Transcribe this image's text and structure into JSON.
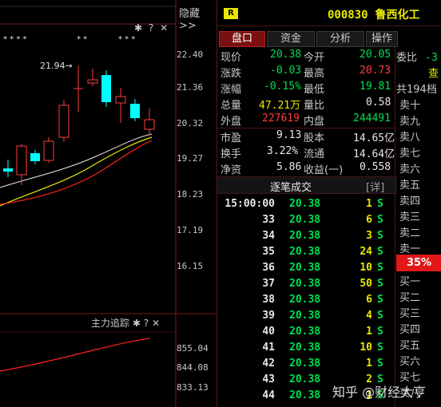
{
  "chart": {
    "hide_label": "隐藏>>",
    "ytick_labels": [
      "22.40",
      "21.36",
      "20.32",
      "19.27",
      "18.23",
      "17.19",
      "16.15"
    ],
    "price_annotation": "21.94→",
    "indicator_title": "主力追踪",
    "indicator_ticks": [
      "855.04",
      "844.08",
      "833.13"
    ],
    "question_label": "?",
    "close_label": "✕"
  },
  "header": {
    "badge": "R",
    "code": "000830",
    "name": "鲁西化工"
  },
  "tabs": [
    {
      "label": "盘口",
      "active": true
    },
    {
      "label": "资金",
      "active": false
    },
    {
      "label": "分析",
      "active": false
    },
    {
      "label": "操作",
      "active": false
    }
  ],
  "quote": {
    "xianjia_label": "现价",
    "xianjia": "20.38",
    "jinkai_label": "今开",
    "jinkai": "20.05",
    "zhangdie_label": "涨跌",
    "zhangdie": "-0.03",
    "zuigao_label": "最高",
    "zuigao": "20.73",
    "zhangfu_label": "涨幅",
    "zhangfu": "-0.15%",
    "zuidi_label": "最低",
    "zuidi": "19.81",
    "zongliang_label": "总量",
    "zongliang": "47.21万",
    "liangbi_label": "量比",
    "liangbi": "0.58",
    "waipan_label": "外盘",
    "waipan": "227619",
    "neipan_label": "内盘",
    "neipan": "244491",
    "shiying_label": "市盈",
    "shiying": "9.13",
    "guben_label": "股本",
    "guben": "14.65亿",
    "huanshou_label": "换手",
    "huanshou": "3.22%",
    "liutong_label": "流通",
    "liutong": "14.64亿",
    "jingzi_label": "净资",
    "jingzi": "5.86",
    "shouyi_label": "收益(一)",
    "shouyi": "0.558"
  },
  "trades": {
    "title": "逐笔成交",
    "detail_label": "[详]",
    "rows": [
      {
        "time": "15:00:00",
        "price": "20.38",
        "vol": "1",
        "side": "S"
      },
      {
        "time": "33",
        "price": "20.38",
        "vol": "6",
        "side": "S"
      },
      {
        "time": "34",
        "price": "20.38",
        "vol": "3",
        "side": "S"
      },
      {
        "time": "35",
        "price": "20.38",
        "vol": "24",
        "side": "S"
      },
      {
        "time": "36",
        "price": "20.38",
        "vol": "10",
        "side": "S"
      },
      {
        "time": "37",
        "price": "20.38",
        "vol": "50",
        "side": "S"
      },
      {
        "time": "38",
        "price": "20.38",
        "vol": "6",
        "side": "S"
      },
      {
        "time": "39",
        "price": "20.38",
        "vol": "4",
        "side": "S"
      },
      {
        "time": "40",
        "price": "20.38",
        "vol": "1",
        "side": "S"
      },
      {
        "time": "41",
        "price": "20.38",
        "vol": "10",
        "side": "S"
      },
      {
        "time": "42",
        "price": "20.38",
        "vol": "1",
        "side": "S"
      },
      {
        "time": "43",
        "price": "20.38",
        "vol": "2",
        "side": "S"
      },
      {
        "time": "44",
        "price": "20.38",
        "vol": "1",
        "side": "S"
      }
    ]
  },
  "orderbook": {
    "weibi_label": "委比",
    "weibi": "-3",
    "cha_label": "查",
    "total_label": "共194档",
    "sell_levels": [
      "卖十",
      "卖九",
      "卖八",
      "卖七",
      "卖六",
      "卖五",
      "卖四",
      "卖三",
      "卖二",
      "卖一"
    ],
    "percent": "35%",
    "buy_levels": [
      "买一",
      "买二",
      "买三",
      "买四",
      "买五",
      "买六",
      "买七",
      "买八"
    ]
  },
  "watermark": "知乎 @财经大亨",
  "colors": {
    "up": "#ff3c3c",
    "down": "#00e050",
    "accent": "#e8e800",
    "candle_down": "#00ffff",
    "tab_active": "#7a1010"
  }
}
